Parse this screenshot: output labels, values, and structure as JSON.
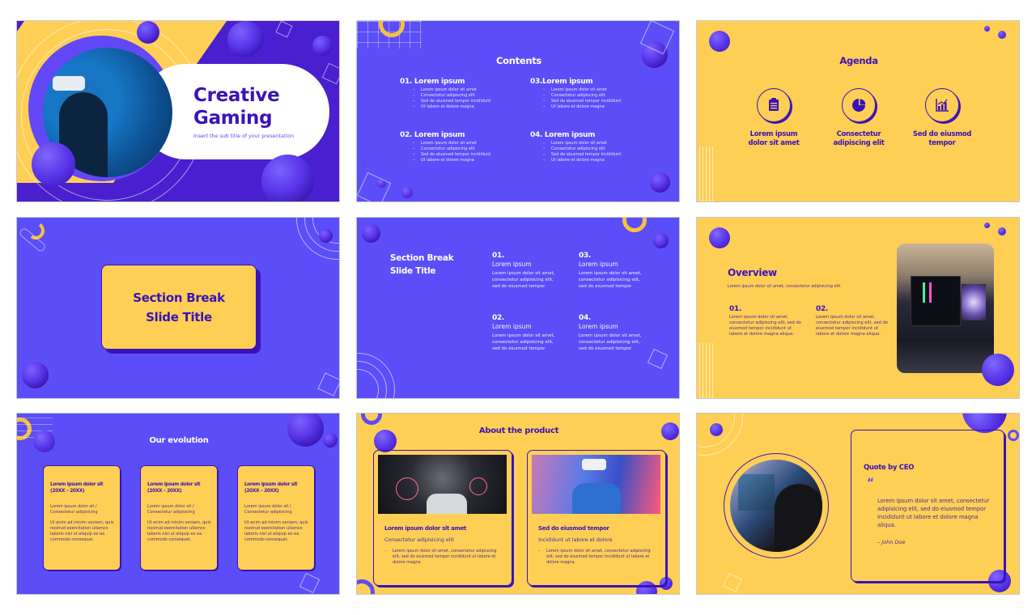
{
  "colors": {
    "purple": "#5b4ef8",
    "dark_purple": "#4a1fd0",
    "yellow": "#ffcf55",
    "navy_text": "#3a13b8",
    "white": "#ffffff"
  },
  "slides": [
    {
      "id": 1,
      "title_line1": "Creative",
      "title_line2": "Gaming",
      "subtitle": "Insert the sub title of your presentation",
      "image": "vr-headset-person-photo"
    },
    {
      "id": 2,
      "title": "Contents",
      "sections": [
        {
          "heading": "01. Lorem ipsum",
          "items": [
            "Lorem ipsum dolor sit amet",
            "Consectetur adipiscing elit",
            "Sed do eiusmod tempor incididunt",
            "Ut labore et dolore magna"
          ]
        },
        {
          "heading": "02. Lorem ipsum",
          "items": [
            "Lorem ipsum dolor sit amet",
            "Consectetur adipiscing elit",
            "Sed do eiusmod tempor incididunt",
            "Ut labore et dolore magna"
          ]
        },
        {
          "heading": "03.Lorem ipsum",
          "items": [
            "Lorem ipsum dolor sit amet",
            "Consectetur adipiscing elit",
            "Sed do eiusmod tempor incididunt",
            "Ut labore et dolore magna"
          ]
        },
        {
          "heading": "04. Lorem ipsum",
          "items": [
            "Lorem ipsum dolor sit amet",
            "Consectetur adipiscing elit",
            "Sed do eiusmod tempor incididunt",
            "Ut labore et dolore magna"
          ]
        }
      ]
    },
    {
      "id": 3,
      "title": "Agenda",
      "items": [
        {
          "icon": "clipboard-icon",
          "line1": "Lorem ipsum",
          "line2": "dolor sit amet"
        },
        {
          "icon": "pie-chart-icon",
          "line1": "Consectetur",
          "line2": "adipiscing elit"
        },
        {
          "icon": "bar-chart-icon",
          "line1": "Sed do eiusmod",
          "line2": "tempor"
        }
      ]
    },
    {
      "id": 4,
      "title_line1": "Section Break",
      "title_line2": "Slide Title"
    },
    {
      "id": 5,
      "title_line1": "Section Break",
      "title_line2": "Slide Title",
      "items": [
        {
          "num": "01.",
          "heading": "Lorem ipsum",
          "body": "Lorem ipsum dolor sit amet, consectetur adipisicing elit, sed do eiusmod tempor"
        },
        {
          "num": "02.",
          "heading": "Lorem ipsum",
          "body": "Lorem ipsum dolor sit amet, consectetur adipisicing elit, sed do eiusmod tempor"
        },
        {
          "num": "03.",
          "heading": "Lorem ipsum",
          "body": "Lorem ipsum dolor sit amet, consectetur adipisicing elit, sed do eiusmod tempor"
        },
        {
          "num": "04.",
          "heading": "Lorem ipsum",
          "body": "Lorem ipsum dolor sit amet, consectetur adipisicing elit, sed do eiusmod tempor"
        }
      ]
    },
    {
      "id": 6,
      "title": "Overview",
      "subtitle": "Lorem ipsum dolor sit amet, consectetur adipisicing elit",
      "items": [
        {
          "num": "01.",
          "body": "Lorem ipsum dolor sit amet, consectetur adipiscing elit, sed do eiusmod tempor incididunt ut labore et dolore magna aliqua."
        },
        {
          "num": "02.",
          "body": "Lorem ipsum dolor sit amet, consectetur adipiscing elit, sed do eiusmod tempor incididunt ut labore et dolore magna aliqua."
        }
      ],
      "image": "gaming-pc-setup-photo"
    },
    {
      "id": 7,
      "title": "Our evolution",
      "cards": [
        {
          "heading": "Lorem ipsum dolor sit (20XX – 20XX)",
          "sub": "Lorem ipsum dolor sit / Consectetur adipisicing",
          "body": "Ut enim ad minim veniam, quis nostrud exercitation ullamco laboris nisi ut aliquip ex ea commodo consequat."
        },
        {
          "heading": "Lorem ipsum dolor sit (20XX – 20XX)",
          "sub": "Lorem ipsum dolor sit / Consectetur adipisicing",
          "body": "Ut enim ad minim veniam, quis nostrud exercitation ullamco laboris nisi ut aliquip ex ea commodo consequat."
        },
        {
          "heading": "Lorem ipsum dolor sit (20XX – 20XX)",
          "sub": "Lorem ipsum dolor sit / Consectetur adipisicing",
          "body": "Ut enim ad minim veniam, quis nostrud exercitation ullamco laboris nisi ut aliquip ex ea commodo consequat."
        }
      ]
    },
    {
      "id": 8,
      "title": "About the product",
      "cards": [
        {
          "image": "vr-boxing-man-photo",
          "heading": "Lorem ipsum dolor sit amet",
          "sub": "Consectetur adipisicing elit",
          "body": "Lorem ipsum dolor sit amet, consectetur adipiscing elit, sed do eiusmod tempor incididunt ut labore et dolore magna"
        },
        {
          "image": "vr-woman-photo",
          "heading": "Sed do eiusmod tempor",
          "sub": "Incididunt ut labore et dolore",
          "body": "Lorem ipsum dolor sit amet, consectetur adipiscing elit, sed do eiusmod tempor incididunt ut labore et dolore magna"
        }
      ]
    },
    {
      "id": 9,
      "title": "Quote by CEO",
      "quote_mark": "“",
      "quote": "Lorem ipsum dolor sit amet, consectetur adipisicing elit, sed do eiusmod tempor incididunt ut labore et dolore magna aliqua.",
      "author": "– John Doe",
      "image": "gamer-at-pc-photo"
    }
  ]
}
